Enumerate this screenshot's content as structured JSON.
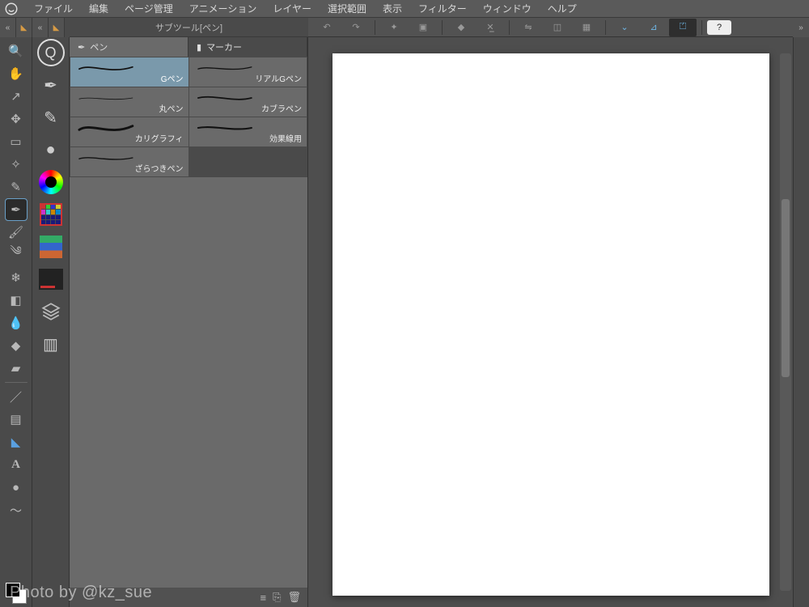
{
  "menu": {
    "items": [
      "ファイル",
      "編集",
      "ページ管理",
      "アニメーション",
      "レイヤー",
      "選択範囲",
      "表示",
      "フィルター",
      "ウィンドウ",
      "ヘルプ"
    ]
  },
  "subtool": {
    "panel_title": "サブツール[ペン]",
    "tabs": [
      {
        "label": "ペン",
        "icon": "pen-nib-icon",
        "active": true
      },
      {
        "label": "マーカー",
        "icon": "marker-icon",
        "active": false
      }
    ],
    "items": [
      {
        "label": "Gペン",
        "selected": true
      },
      {
        "label": "リアルGペン",
        "selected": false
      },
      {
        "label": "丸ペン",
        "selected": false
      },
      {
        "label": "カブラペン",
        "selected": false
      },
      {
        "label": "カリグラフィ",
        "selected": false
      },
      {
        "label": "効果線用",
        "selected": false
      },
      {
        "label": "ざらつきペン",
        "selected": false
      }
    ],
    "footer_icons": [
      "menu-icon",
      "duplicate-icon",
      "trash-icon"
    ]
  },
  "toolbar": {
    "buttons": [
      {
        "name": "undo-icon"
      },
      {
        "name": "redo-icon"
      },
      {
        "name": "sep"
      },
      {
        "name": "clear-icon"
      },
      {
        "name": "fit-icon"
      },
      {
        "name": "sep"
      },
      {
        "name": "lasso-fill-icon"
      },
      {
        "name": "transform-icon"
      },
      {
        "name": "sep"
      },
      {
        "name": "flip-icon"
      },
      {
        "name": "rotate-canvas-icon"
      },
      {
        "name": "crop-icon"
      },
      {
        "name": "sep"
      },
      {
        "name": "snap1-icon",
        "snap": true
      },
      {
        "name": "snap2-icon",
        "snap": true
      },
      {
        "name": "snap3-icon",
        "snap": true,
        "active": true
      },
      {
        "name": "sep"
      },
      {
        "name": "help-icon",
        "help": true
      }
    ]
  },
  "toolbox": [
    {
      "name": "magnify-icon"
    },
    {
      "name": "move-hand-icon"
    },
    {
      "name": "operation-icon"
    },
    {
      "name": "move-layer-icon"
    },
    {
      "name": "marquee-icon"
    },
    {
      "name": "wand-icon"
    },
    {
      "name": "eyedropper-icon"
    },
    {
      "name": "pen-icon",
      "selected": true
    },
    {
      "name": "brush-icon"
    },
    {
      "name": "airbrush-icon"
    },
    {
      "name": "decoration-icon"
    },
    {
      "name": "eraser-icon"
    },
    {
      "name": "blend-icon"
    },
    {
      "name": "fill-icon"
    },
    {
      "name": "gradient-icon"
    },
    {
      "name": "divider"
    },
    {
      "name": "figure-line-icon"
    },
    {
      "name": "frame-icon"
    },
    {
      "name": "ruler-triangle-icon"
    },
    {
      "name": "text-a-icon"
    },
    {
      "name": "balloon-icon"
    },
    {
      "name": "correct-line-icon"
    }
  ],
  "palette_column": [
    {
      "name": "quick-access-icon"
    },
    {
      "name": "subtool-pen-icon"
    },
    {
      "name": "subtool-detail-icon"
    },
    {
      "name": "brush-size-icon"
    },
    {
      "name": "color-wheel-icon"
    },
    {
      "name": "color-set-icon"
    },
    {
      "name": "timeline-icon"
    },
    {
      "name": "auto-action-icon"
    },
    {
      "name": "layers-icon"
    },
    {
      "name": "layer-property-icon"
    }
  ],
  "watermark": "Photo by @kz_sue"
}
